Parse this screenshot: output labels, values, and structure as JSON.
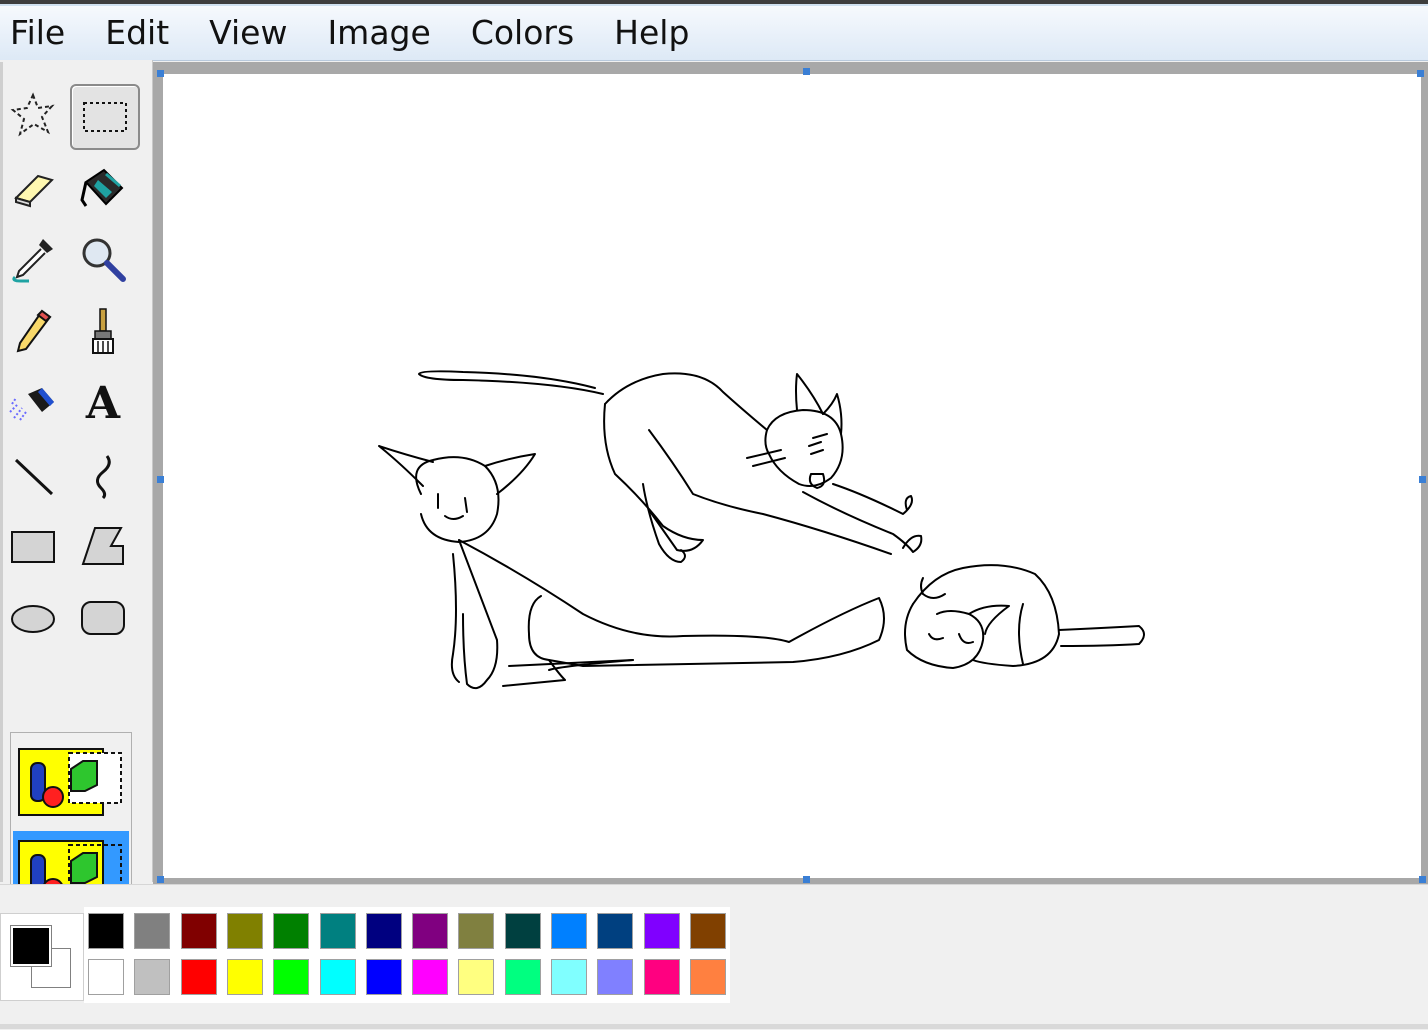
{
  "menu": {
    "items": [
      "File",
      "Edit",
      "View",
      "Image",
      "Colors",
      "Help"
    ]
  },
  "toolbox": {
    "tools": [
      {
        "name": "free-form-select-icon",
        "selected": false
      },
      {
        "name": "rectangle-select-icon",
        "selected": true
      },
      {
        "name": "eraser-icon",
        "selected": false
      },
      {
        "name": "fill-bucket-icon",
        "selected": false
      },
      {
        "name": "color-picker-icon",
        "selected": false
      },
      {
        "name": "magnifier-icon",
        "selected": false
      },
      {
        "name": "pencil-icon",
        "selected": false
      },
      {
        "name": "brush-icon",
        "selected": false
      },
      {
        "name": "airbrush-icon",
        "selected": false
      },
      {
        "name": "text-icon",
        "selected": false
      },
      {
        "name": "line-icon",
        "selected": false
      },
      {
        "name": "curve-icon",
        "selected": false
      },
      {
        "name": "rectangle-icon",
        "selected": false
      },
      {
        "name": "polygon-icon",
        "selected": false
      },
      {
        "name": "ellipse-icon",
        "selected": false
      },
      {
        "name": "rounded-rectangle-icon",
        "selected": false
      }
    ],
    "text_tool_glyph": "A",
    "selection_options": [
      {
        "name": "opaque-selection-icon",
        "selected": false
      },
      {
        "name": "transparent-selection-icon",
        "selected": true
      }
    ]
  },
  "colors": {
    "foreground": "#000000",
    "background": "#ffffff",
    "palette_top": [
      "#000000",
      "#808080",
      "#800000",
      "#808000",
      "#008000",
      "#008080",
      "#000080",
      "#800080",
      "#808040",
      "#004040",
      "#0080ff",
      "#004080",
      "#8000ff",
      "#804000"
    ],
    "palette_bottom": [
      "#ffffff",
      "#c0c0c0",
      "#ff0000",
      "#ffff00",
      "#00ff00",
      "#00ffff",
      "#0000ff",
      "#ff00ff",
      "#ffff80",
      "#00ff80",
      "#80ffff",
      "#8080ff",
      "#ff0080",
      "#ff8040"
    ],
    "workspace": "#a8a8a8",
    "handle": "#3a7fd5",
    "selected_option": "#3399ff"
  }
}
